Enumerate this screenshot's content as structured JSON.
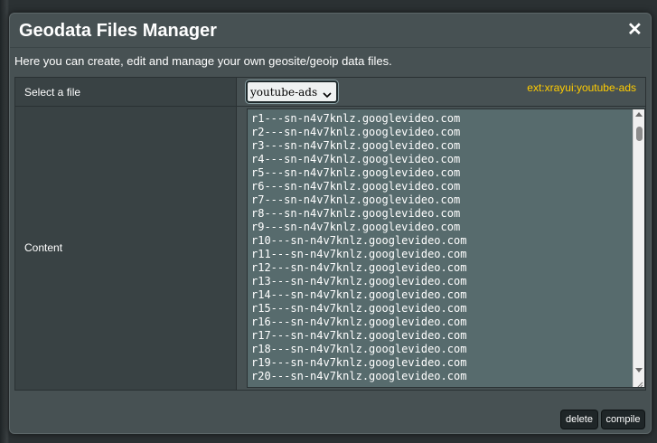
{
  "modal": {
    "title": "Geodata Files Manager",
    "close_symbol": "✕",
    "description": "Here you can create, edit and manage your own geosite/geoip data files."
  },
  "file_row": {
    "label": "Select a file",
    "selected_file": "youtube-ads",
    "ext_tag": "ext:xrayui:youtube-ads"
  },
  "content_row": {
    "label": "Content",
    "lines": [
      "r1---sn-n4v7knlz.googlevideo.com",
      "r2---sn-n4v7knlz.googlevideo.com",
      "r3---sn-n4v7knlz.googlevideo.com",
      "r4---sn-n4v7knlz.googlevideo.com",
      "r5---sn-n4v7knlz.googlevideo.com",
      "r6---sn-n4v7knlz.googlevideo.com",
      "r7---sn-n4v7knlz.googlevideo.com",
      "r8---sn-n4v7knlz.googlevideo.com",
      "r9---sn-n4v7knlz.googlevideo.com",
      "r10---sn-n4v7knlz.googlevideo.com",
      "r11---sn-n4v7knlz.googlevideo.com",
      "r12---sn-n4v7knlz.googlevideo.com",
      "r13---sn-n4v7knlz.googlevideo.com",
      "r14---sn-n4v7knlz.googlevideo.com",
      "r15---sn-n4v7knlz.googlevideo.com",
      "r16---sn-n4v7knlz.googlevideo.com",
      "r17---sn-n4v7knlz.googlevideo.com",
      "r18---sn-n4v7knlz.googlevideo.com",
      "r19---sn-n4v7knlz.googlevideo.com",
      "r20---sn-n4v7knlz.googlevideo.com"
    ]
  },
  "buttons": {
    "delete": "delete",
    "compile": "compile"
  },
  "icons": {
    "close": "close-icon",
    "select_chevron": "chevron-down-icon",
    "scroll_up": "scroll-up-icon",
    "scroll_down": "scroll-down-icon",
    "resize": "resize-grip-icon"
  },
  "colors": {
    "ext_tag": "#ffcc00",
    "modal_bg": "#475153",
    "textarea_bg": "#576b6d"
  }
}
